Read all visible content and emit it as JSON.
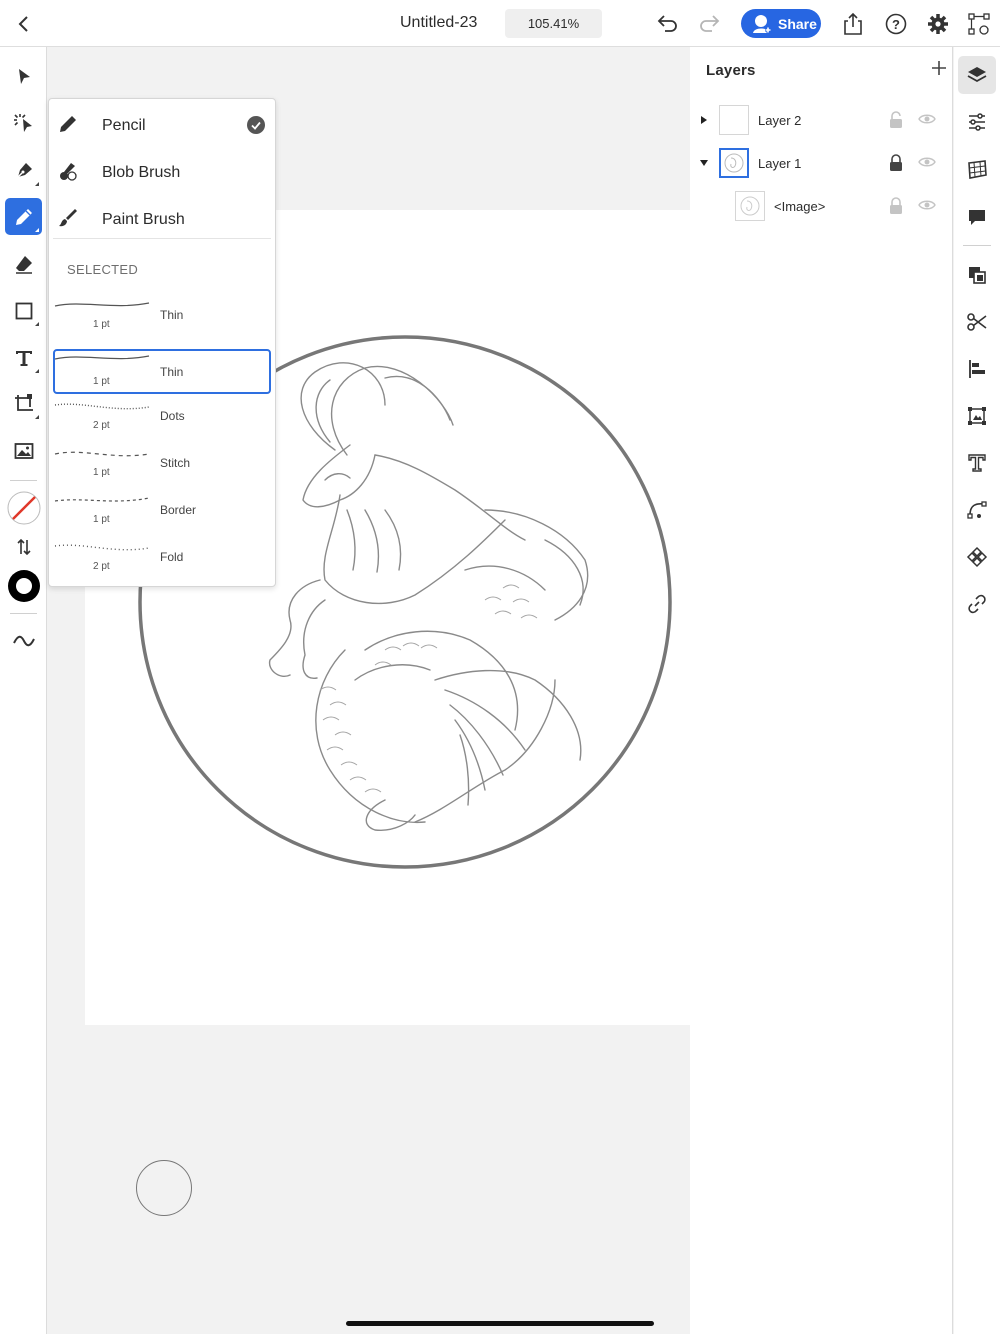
{
  "topbar": {
    "title": "Untitled-23",
    "zoom": "105.41%",
    "share_label": "Share",
    "share_color": "#2766e2"
  },
  "left_tools": [
    {
      "name": "selection-tool",
      "icon": "arrow-icon"
    },
    {
      "name": "direct-selection-tool",
      "icon": "direct-select-icon"
    },
    {
      "name": "pen-tool",
      "icon": "pen-nib-icon"
    },
    {
      "name": "pencil-tool",
      "icon": "pencil-icon",
      "active": true
    },
    {
      "name": "eraser-tool",
      "icon": "eraser-icon"
    },
    {
      "name": "shape-tool",
      "icon": "rectangle-icon"
    },
    {
      "name": "type-tool",
      "icon": "text-t-icon"
    },
    {
      "name": "transform-tool",
      "icon": "transform-icon"
    },
    {
      "name": "place-image-tool",
      "icon": "image-icon"
    }
  ],
  "brush_popover": {
    "brushes": [
      {
        "label": "Pencil",
        "icon": "pencil-icon",
        "checked": true
      },
      {
        "label": "Blob Brush",
        "icon": "blob-brush-icon",
        "checked": false
      },
      {
        "label": "Paint Brush",
        "icon": "paint-brush-icon",
        "checked": false
      }
    ],
    "section_label": "SELECTED",
    "strokes": [
      {
        "name": "Thin",
        "size": "1 pt",
        "style": "solid"
      },
      {
        "name": "Thin",
        "size": "1 pt",
        "style": "solid",
        "selected": true
      },
      {
        "name": "Dots",
        "size": "2 pt",
        "style": "dots"
      },
      {
        "name": "Stitch",
        "size": "1 pt",
        "style": "stitch"
      },
      {
        "name": "Border",
        "size": "1 pt",
        "style": "dash"
      },
      {
        "name": "Fold",
        "size": "2 pt",
        "style": "fold"
      }
    ]
  },
  "layers": {
    "title": "Layers",
    "items": [
      {
        "name": "Layer 2",
        "expanded": false,
        "locked": false,
        "visible": true
      },
      {
        "name": "Layer 1",
        "expanded": true,
        "locked": true,
        "visible": true,
        "selected": true
      },
      {
        "name": "<Image>",
        "child": true,
        "locked": true,
        "visible": true
      }
    ]
  },
  "right_tools": [
    {
      "name": "layers-panel-tool",
      "icon": "layers-icon",
      "active": true
    },
    {
      "name": "properties-tool",
      "icon": "sliders-icon"
    },
    {
      "name": "grid-tool",
      "icon": "grid-icon"
    },
    {
      "name": "comments-tool",
      "icon": "comment-icon"
    },
    {
      "name": "arrange-tool",
      "icon": "arrange-icon"
    },
    {
      "name": "cut-tool",
      "icon": "scissors-icon"
    },
    {
      "name": "align-tool",
      "icon": "align-icon"
    },
    {
      "name": "image-trace-tool",
      "icon": "image-trace-icon"
    },
    {
      "name": "text-tool",
      "icon": "text-outline-icon"
    },
    {
      "name": "path-tool",
      "icon": "path-icon"
    },
    {
      "name": "repeat-tool",
      "icon": "repeat-icon"
    },
    {
      "name": "link-tool",
      "icon": "link-icon"
    }
  ],
  "colors": {
    "accent": "#2e6fe0",
    "fill_swatch": "none",
    "stroke_swatch": "#000000"
  }
}
